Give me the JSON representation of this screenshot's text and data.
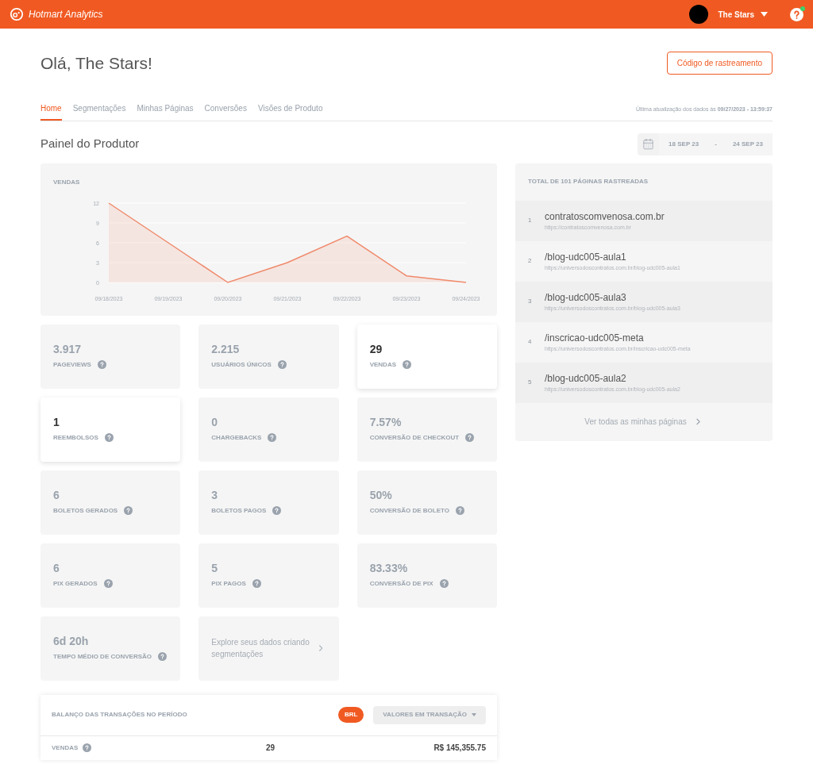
{
  "app": {
    "name": "Hotmart Analytics",
    "user": "The Stars"
  },
  "greeting": "Olá, The Stars!",
  "tracking_button": "Código de rastreamento",
  "tabs": [
    {
      "label": "Home",
      "selected": true
    },
    {
      "label": "Segmentações",
      "selected": false
    },
    {
      "label": "Minhas Páginas",
      "selected": false
    },
    {
      "label": "Conversões",
      "selected": false
    },
    {
      "label": "Visões de Produto",
      "selected": false
    }
  ],
  "last_update": "Última atualização dos dados às **09/27/2023 - 13:59:37**",
  "section_title": "Painel do Produtor",
  "date_range": {
    "start": "18 SEP 23",
    "separator": "-",
    "end": "24 SEP 23"
  },
  "sales_chart": {
    "title": "VENDAS",
    "chart_data": {
      "type": "area",
      "categories": [
        "09/18/2023",
        "09/19/2023",
        "09/20/2023",
        "09/21/2023",
        "09/22/2023",
        "09/23/2023",
        "09/24/2023"
      ],
      "series": [
        {
          "color": "#f08a6c",
          "values": [
            12,
            6,
            0,
            3,
            7,
            1,
            0
          ]
        }
      ],
      "ylim": [
        0,
        12
      ],
      "yticks": [
        0,
        3,
        6,
        9,
        12
      ]
    }
  },
  "metrics": [
    {
      "value": "3.917",
      "label": "PAGEVIEWS",
      "selected": false
    },
    {
      "value": "2.215",
      "label": "USUÁRIOS ÚNICOS",
      "selected": false
    },
    {
      "value": "29",
      "label": "VENDAS",
      "selected": true
    },
    {
      "value": "1",
      "label": "REEMBOLSOS",
      "selected": true
    },
    {
      "value": "0",
      "label": "CHARGEBACKS",
      "selected": false
    },
    {
      "value": "7.57%",
      "label": "CONVERSÃO DE CHECKOUT",
      "selected": false
    },
    {
      "value": "6",
      "label": "BOLETOS GERADOS",
      "selected": false
    },
    {
      "value": "3",
      "label": "BOLETOS PAGOS",
      "selected": false
    },
    {
      "value": "50%",
      "label": "CONVERSÃO DE BOLETO",
      "selected": false
    },
    {
      "value": "6",
      "label": "PIX GERADOS",
      "selected": false
    },
    {
      "value": "5",
      "label": "PIX PAGOS",
      "selected": false
    },
    {
      "value": "83.33%",
      "label": "CONVERSÃO DE PIX",
      "selected": false
    },
    {
      "value": "6d 20h",
      "label": "TEMPO MÉDIO DE CONVERSÃO",
      "selected": false
    }
  ],
  "explore_link": "Explore seus dados criando segmentações",
  "pages": {
    "title": "TOTAL DE 101 PÁGINAS RASTREADAS",
    "items": [
      {
        "rank": "1",
        "name": "contratoscomvenosa.com.br",
        "url": "https://contratoscomvenosa.com.br"
      },
      {
        "rank": "2",
        "name": "/blog-udc005-aula1",
        "url": "https://universodoscontratos.com.br/blog-udc005-aula1"
      },
      {
        "rank": "3",
        "name": "/blog-udc005-aula3",
        "url": "https://universodoscontratos.com.br/blog-udc005-aula3"
      },
      {
        "rank": "4",
        "name": "/inscricao-udc005-meta",
        "url": "https://universodoscontratos.com.br/inscricao-udc005-meta"
      },
      {
        "rank": "5",
        "name": "/blog-udc005-aula2",
        "url": "https://universodoscontratos.com.br/blog-udc005-aula2"
      }
    ],
    "see_all": "Ver todas as minhas páginas"
  },
  "balance": {
    "title": "BALANÇO DAS TRANSAÇÕES NO PERÍODO",
    "currency": "BRL",
    "mode": "VALORES EM TRANSAÇÃO",
    "rows": [
      {
        "label": "VENDAS",
        "count": "29",
        "amount": "R$ 145,355.75"
      }
    ]
  }
}
